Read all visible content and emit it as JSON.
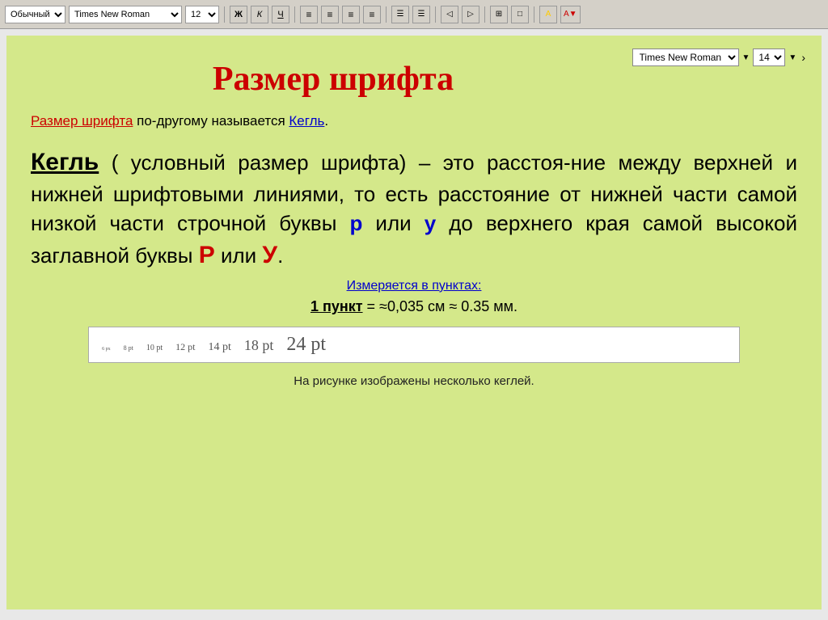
{
  "toolbar": {
    "style_label": "Обычный",
    "font_label": "Times New Roman",
    "size_label": "12",
    "bold_label": "Ж",
    "italic_label": "К",
    "underline_label": "Ч"
  },
  "font_box": {
    "font_name": "Times New Roman",
    "font_size": "14"
  },
  "content": {
    "title": "Размер шрифта",
    "subtitle_part1": "Размер шрифта",
    "subtitle_part2": " по-другому называется ",
    "subtitle_link": "Кегль",
    "subtitle_end": ".",
    "kegl_term": "Кегль",
    "paragraph_text1": " ( условный размер шрифта) – это расстоя-ние между верхней и нижней шрифтовыми линиями, то есть расстояние от нижней части самой низкой части строчной буквы ",
    "letter_p": "р",
    "paragraph_text2": " или ",
    "letter_y": "у",
    "paragraph_text3": " до верхнего края самой высокой заглавной буквы ",
    "letter_P_big": "Р",
    "paragraph_text4": " или ",
    "letter_Y_big": "У",
    "paragraph_end": ".",
    "measured_label": "Измеряется в пунктах:",
    "one_point_label": "1 пункт",
    "one_point_eq": " = ≈0,035 см ≈ 0.35 мм.",
    "sizes": [
      {
        "label": "6 рх",
        "class": "size-6"
      },
      {
        "label": "8 pt",
        "class": "size-8"
      },
      {
        "label": "10 pt",
        "class": "size-10"
      },
      {
        "label": "12 pt",
        "class": "size-12"
      },
      {
        "label": "14 pt",
        "class": "size-14"
      },
      {
        "label": "18 pt",
        "class": "size-18"
      },
      {
        "label": "24 pt",
        "class": "size-24"
      }
    ],
    "caption": "На рисунке изображены несколько кеглей."
  }
}
